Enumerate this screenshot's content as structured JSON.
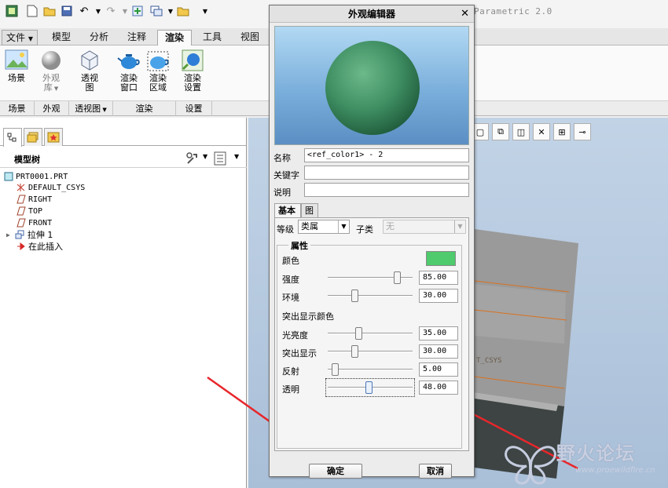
{
  "app": {
    "title": "Parametric 2.0"
  },
  "ribbon": {
    "tabs": [
      {
        "label": "文件"
      },
      {
        "label": "模型"
      },
      {
        "label": "分析"
      },
      {
        "label": "注释"
      },
      {
        "label": "渲染",
        "active": true
      },
      {
        "label": "工具"
      },
      {
        "label": "视图"
      }
    ],
    "buttons": {
      "scene": "场景",
      "appearance_lib_1": "外观",
      "appearance_lib_2": "库",
      "perspective_1": "透视",
      "perspective_2": "图",
      "render_window_1": "渲染",
      "render_window_2": "窗口",
      "render_region_1": "渲染",
      "render_region_2": "区域",
      "render_setup_1": "渲染",
      "render_setup_2": "设置"
    },
    "groups": [
      "场景",
      "外观",
      "透视图",
      "渲染",
      "设置"
    ]
  },
  "model_tree": {
    "title": "模型树",
    "items": [
      {
        "label": "PRT0001.PRT",
        "icon": "part-icon"
      },
      {
        "label": "DEFAULT_CSYS",
        "icon": "csys-icon"
      },
      {
        "label": "RIGHT",
        "icon": "datum-plane-icon"
      },
      {
        "label": "TOP",
        "icon": "datum-plane-icon"
      },
      {
        "label": "FRONT",
        "icon": "datum-plane-icon"
      },
      {
        "label": "拉伸 1",
        "icon": "extrude-icon"
      },
      {
        "label": "在此插入",
        "icon": "insert-here-arrow-icon"
      }
    ]
  },
  "graphics": {
    "csys_label": "T_CSYS"
  },
  "dialog": {
    "title": "外观编辑器",
    "name_label": "名称",
    "name_value": "<ref_color1> - 2",
    "keyword_label": "关键字",
    "keyword_value": "",
    "description_label": "说明",
    "description_value": "",
    "tabs": [
      {
        "label": "基本",
        "active": true
      },
      {
        "label": "图"
      }
    ],
    "class_label": "等级",
    "class_value": "类属",
    "subclass_label": "子类",
    "subclass_value": "无",
    "properties_title": "属性",
    "color_label": "颜色",
    "color_value": "#4fca6c",
    "intensity_label": "强度",
    "intensity_value": "85.00",
    "ambient_label": "环境",
    "ambient_value": "30.00",
    "highlight_color_label": "突出显示颜色",
    "shininess_label": "光亮度",
    "shininess_value": "35.00",
    "highlight_label": "突出显示",
    "highlight_value": "30.00",
    "reflection_label": "反射",
    "reflection_value": "5.00",
    "transparency_label": "透明",
    "transparency_value": "48.00",
    "ok_label": "确定",
    "cancel_label": "取消"
  },
  "watermark": {
    "text_cn": "野火论坛",
    "url": "www.proewildfire.cn"
  },
  "colors": {
    "sphere": "#3f8f63",
    "annotation_arrow": "#e8262b"
  }
}
